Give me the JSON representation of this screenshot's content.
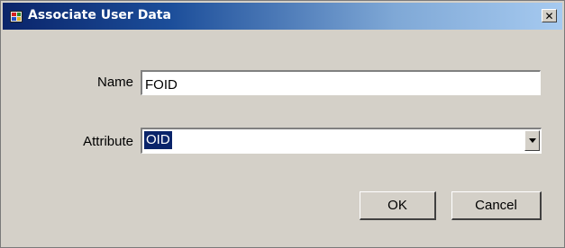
{
  "window": {
    "title": "Associate User Data",
    "close_symbol": "✕"
  },
  "form": {
    "name_label": "Name",
    "name_value": "FOID",
    "attribute_label": "Attribute",
    "attribute_selected": "OID"
  },
  "buttons": {
    "ok_label": "OK",
    "cancel_label": "Cancel"
  },
  "icons": {
    "app": "app-window-icon",
    "close": "close-icon",
    "dropdown": "chevron-down-icon"
  }
}
